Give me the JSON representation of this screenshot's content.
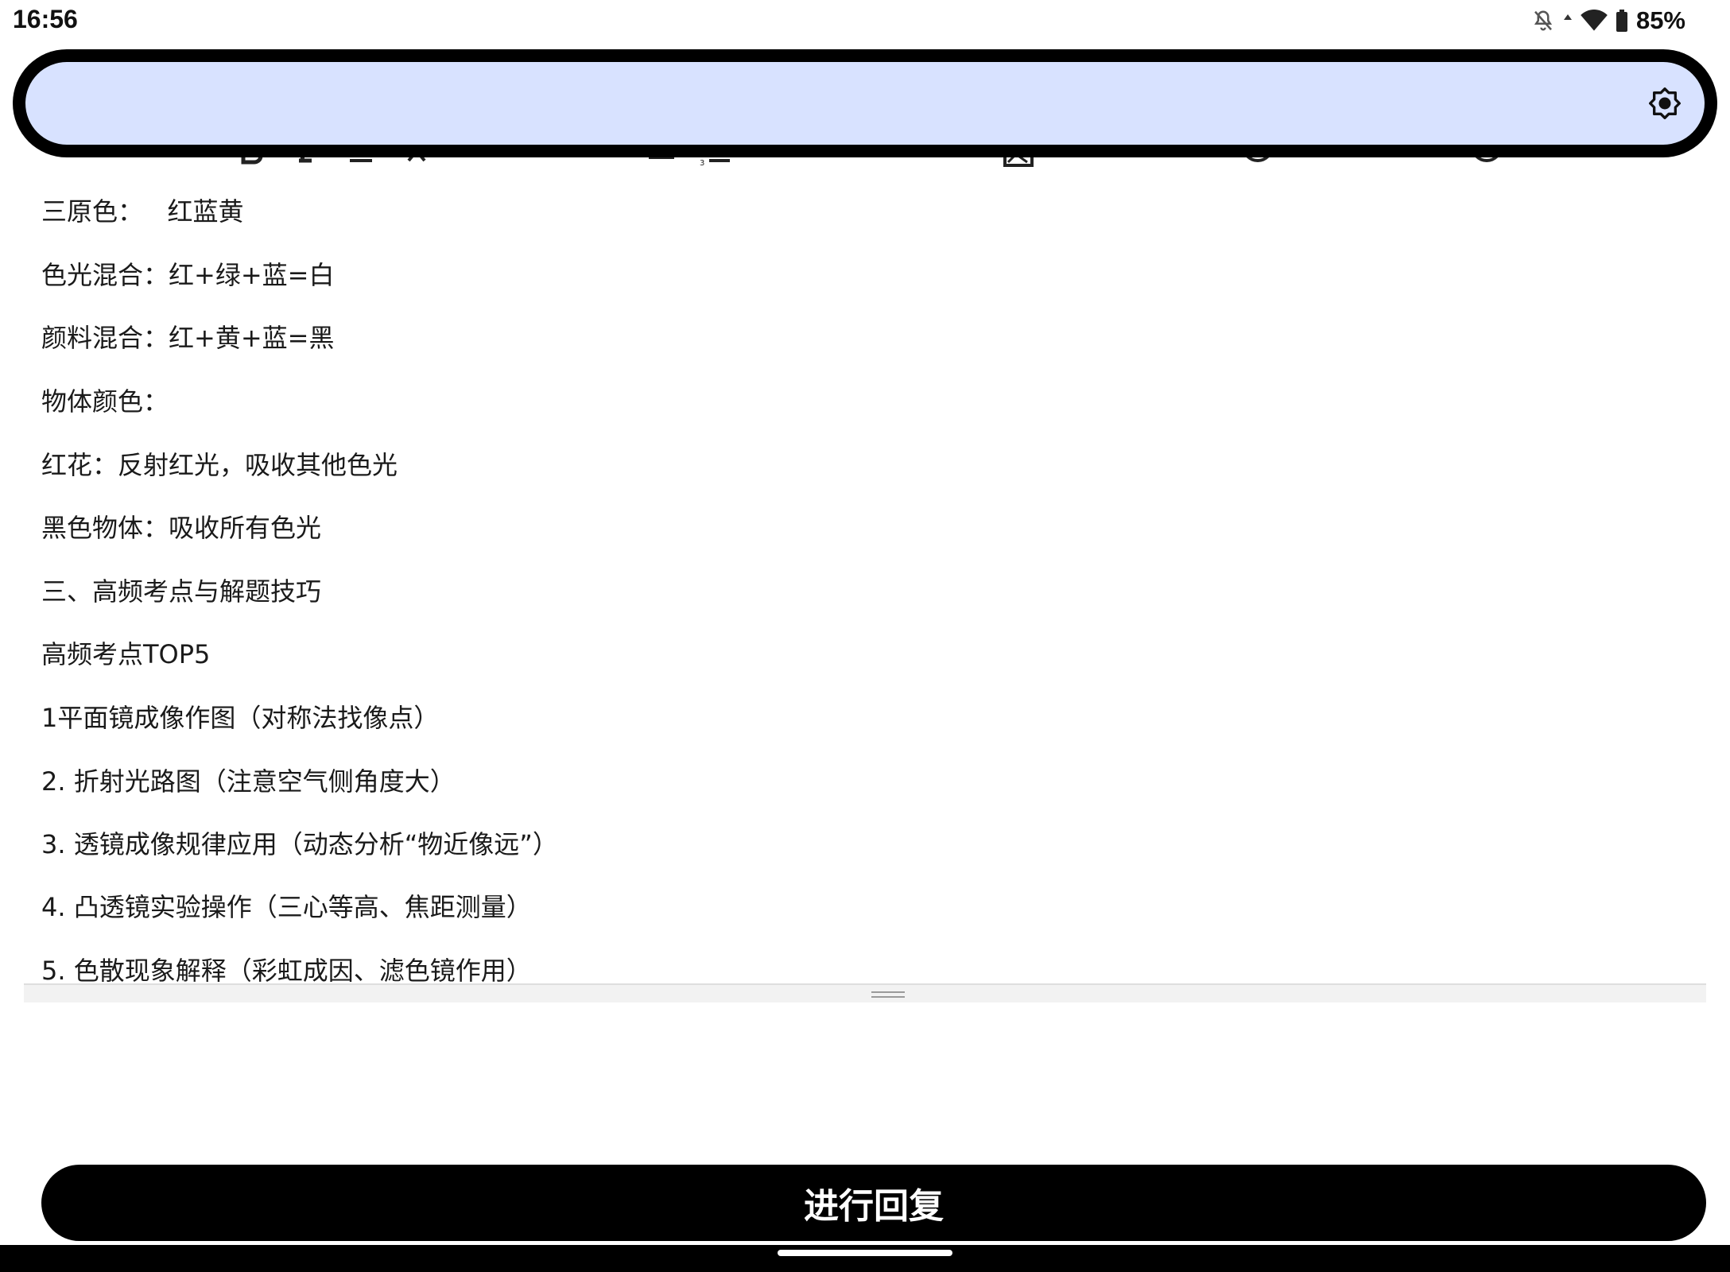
{
  "status_bar": {
    "time": "16:56",
    "battery_percent": "85%",
    "icons": [
      "bell-off-icon",
      "data-arrow-icon",
      "wifi-icon",
      "battery-icon"
    ]
  },
  "toolbar": {
    "icons": [
      "bold-icon",
      "italic-icon",
      "underline-icon",
      "clear-format-icon",
      "bullet-list-icon",
      "numbered-list-icon",
      "link-icon",
      "image-icon",
      "emoji-icon",
      "mention-icon"
    ]
  },
  "top_bar": {
    "settings_icon": "brightness-settings-icon",
    "background": "#d8e2ff"
  },
  "editor": {
    "lines": [
      "三原色：   红蓝黄",
      "色光混合：红+绿+蓝=白",
      "颜料混合：红+黄+蓝=黑",
      "物体颜色：",
      "红花：反射红光，吸收其他色光",
      "黑色物体：吸收所有色光",
      "三、高频考点与解题技巧",
      "高频考点TOP5",
      "1平面镜成像作图（对称法找像点）",
      "2. 折射光路图（注意空气侧角度大）",
      "3. 透镜成像规律应用（动态分析“物近像远”）",
      "4. 凸透镜实验操作（三心等高、焦距测量）",
      "5. 色散现象解释（彩虹成因、滤色镜作用）"
    ]
  },
  "reply_button": {
    "label": "进行回复"
  }
}
